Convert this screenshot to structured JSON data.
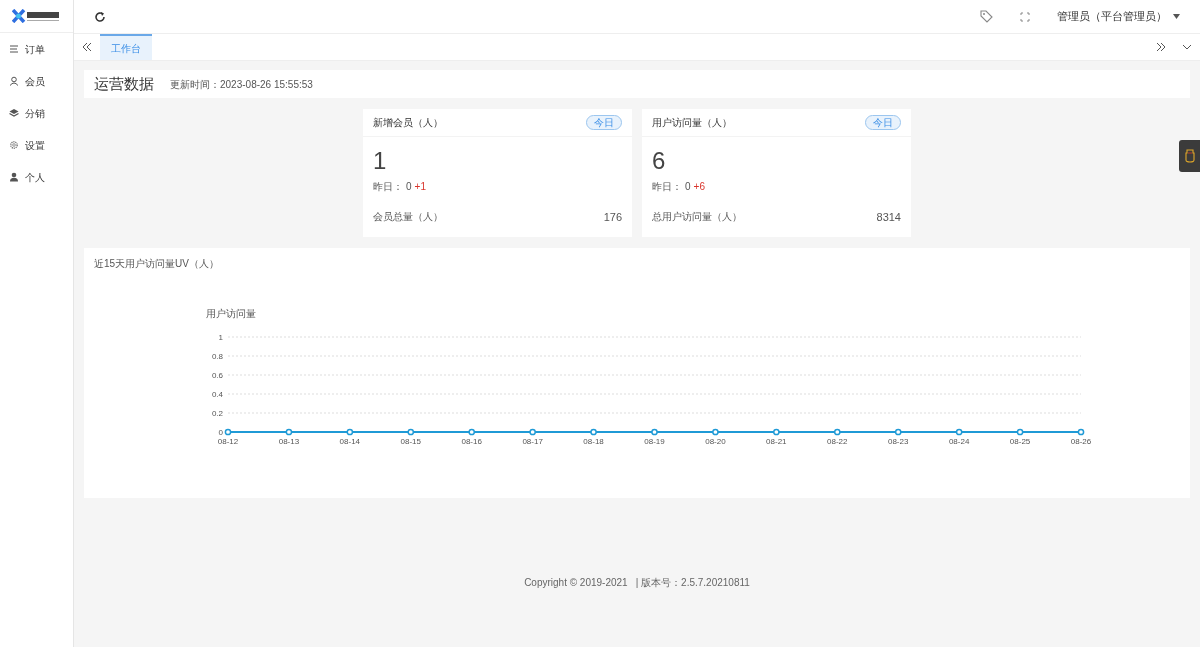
{
  "header": {
    "user": "管理员（平台管理员）"
  },
  "sidebar": {
    "items": [
      {
        "label": "订单"
      },
      {
        "label": "会员"
      },
      {
        "label": "分销"
      },
      {
        "label": "设置"
      },
      {
        "label": "个人"
      }
    ]
  },
  "tabs": [
    {
      "label": "工作台",
      "selected": true
    }
  ],
  "ops": {
    "title": "运营数据",
    "updated": "更新时间：2023-08-26 15:55:53"
  },
  "stats": [
    {
      "title": "新增会员（人）",
      "badge": "今日",
      "value": "1",
      "yesterday_label": "昨日：",
      "yesterday": "0",
      "delta": "+1",
      "total_label": "会员总量（人）",
      "total": "176"
    },
    {
      "title": "用户访问量（人）",
      "badge": "今日",
      "value": "6",
      "yesterday_label": "昨日：",
      "yesterday": "0",
      "delta": "+6",
      "total_label": "总用户访问量（人）",
      "total": "8314"
    }
  ],
  "chart_card": {
    "title": "近15天用户访问量UV（人）",
    "chart_data": {
      "type": "line",
      "ylabel": "用户访问量",
      "categories": [
        "08-12",
        "08-13",
        "08-14",
        "08-15",
        "08-16",
        "08-17",
        "08-18",
        "08-19",
        "08-20",
        "08-21",
        "08-22",
        "08-23",
        "08-24",
        "08-25",
        "08-26"
      ],
      "series": [
        {
          "color": "#1f9ad6",
          "marker": "circle",
          "values": [
            0,
            0,
            0,
            0,
            0,
            0,
            0,
            0,
            0,
            0,
            0,
            0,
            0,
            0,
            0
          ]
        }
      ],
      "grid": true,
      "ylim": [
        0,
        1
      ],
      "yticks": [
        0,
        0.2,
        0.4,
        0.6,
        0.8,
        1
      ]
    }
  },
  "footer": {
    "copyright": "Copyright © 2019-2021",
    "version": "|  版本号：2.5.7.20210811"
  }
}
